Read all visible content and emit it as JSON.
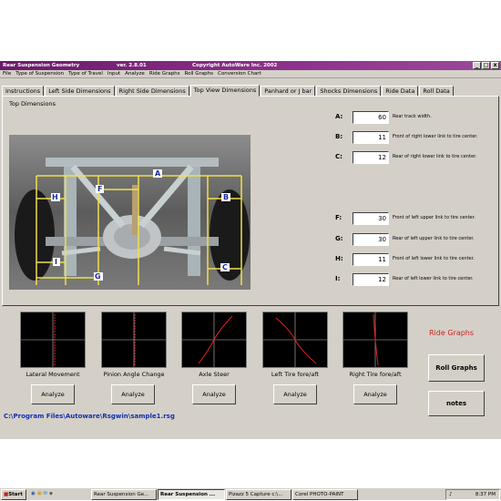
{
  "window": {
    "title": "Rear Suspension Geometry",
    "version": "ver. 2.8.01",
    "copyright": "Copyright AutoWare Inc. 2002",
    "controls": [
      "_",
      "□",
      "x"
    ]
  },
  "menu": [
    "File",
    "Type of Suspension",
    "Type of Travel",
    "Input",
    "Analyze",
    "Ride Graphs",
    "Roll Graphs",
    "Conversion Chart"
  ],
  "tabs": [
    "Instructions",
    "Left Side Dimensions",
    "Right Side Dimensions",
    "Top View Dimensions",
    "Panhard or J bar",
    "Shocks Dimensions",
    "Ride Data",
    "Roll Data"
  ],
  "active_tab": "Top View Dimensions",
  "group_label": "Top Dimensions",
  "photo_labels": {
    "A": "A",
    "B": "B",
    "C": "C",
    "E": "E",
    "F": "F",
    "G": "G",
    "H": "H",
    "I": "I"
  },
  "fields": [
    {
      "label": "A:",
      "value": "60",
      "desc": "Rear track width."
    },
    {
      "label": "B:",
      "value": "11",
      "desc": "Front of right lower link to tire center."
    },
    {
      "label": "C:",
      "value": "12",
      "desc": "Rear of right lower link to tire center."
    },
    {
      "label": "F:",
      "value": "30",
      "desc": "Front of left upper link to tire center."
    },
    {
      "label": "G:",
      "value": "30",
      "desc": "Rear of left upper link to tire center."
    },
    {
      "label": "H:",
      "value": "11",
      "desc": "Front of left lower link to tire center."
    },
    {
      "label": "I:",
      "value": "12",
      "desc": "Rear of left lower link to tire center."
    }
  ],
  "graphs": [
    {
      "caption": "Lateral Movement",
      "button": "Analyze"
    },
    {
      "caption": "Pinion Angle Change",
      "button": "Analyze"
    },
    {
      "caption": "Axle Steer",
      "button": "Analyze"
    },
    {
      "caption": "Left Tire fore/aft",
      "button": "Analyze"
    },
    {
      "caption": "Right Tire fore/aft",
      "button": "Analyze"
    }
  ],
  "ride_graphs_title": "Ride Graphs",
  "roll_graphs_button": "Roll Graphs",
  "notes_button": "notes",
  "file_path": "C:\\Program Files\\Autoware\\Rsgwin\\sample1.rsg",
  "taskbar": {
    "start": "Start",
    "items": [
      "Rear Suspension Ge...",
      "Rear Suspension ...",
      "Pizazz 5 Capture c:\\...",
      "Corel PHOTO-PAINT"
    ],
    "active_index": 1,
    "clock": "8:37 PM"
  },
  "colors": {
    "title_bar": "#8d338d",
    "path_text": "#1030b0",
    "ride_graphs_text": "#d02020",
    "dim_lines": "#f0e04a"
  }
}
